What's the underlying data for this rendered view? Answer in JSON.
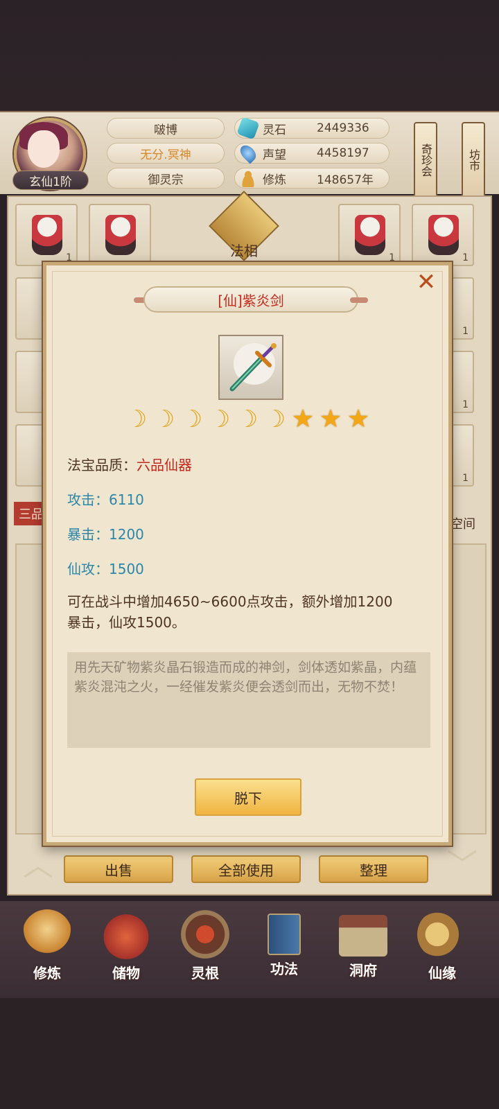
{
  "header": {
    "player_name": "啵博",
    "title": "无分.冥神",
    "sect": "御灵宗",
    "rank": "玄仙1阶",
    "resources": [
      {
        "label": "灵石",
        "value": "2449336",
        "icon": "spirit-stone-icon"
      },
      {
        "label": "声望",
        "value": "4458197",
        "icon": "reputation-icon"
      },
      {
        "label": "修炼",
        "value": "148657年",
        "icon": "meditation-icon"
      }
    ],
    "banners": [
      {
        "label": "奇珍会"
      },
      {
        "label": "坊市"
      }
    ]
  },
  "inventory": {
    "center_label": "法相",
    "left_tab": "三品",
    "right_tab": "子空间",
    "slot_count_value": "1"
  },
  "bottom_buttons": {
    "sell": "出售",
    "use_all": "全部使用",
    "sort": "整理"
  },
  "nav": [
    {
      "label": "修炼",
      "icon": "cultivate-icon"
    },
    {
      "label": "储物",
      "icon": "storage-bag-icon"
    },
    {
      "label": "灵根",
      "icon": "spirit-root-icon"
    },
    {
      "label": "功法",
      "icon": "technique-book-icon"
    },
    {
      "label": "洞府",
      "icon": "cave-mansion-icon"
    },
    {
      "label": "仙缘",
      "icon": "fate-icon"
    }
  ],
  "modal": {
    "title": "[仙]紫炎剑",
    "stars": {
      "moons": 6,
      "stars": 3
    },
    "quality_label": "法宝品质：",
    "quality_value": "六品仙器",
    "attack_label": "攻击：",
    "attack_value": "6110",
    "crit_label": "暴击：",
    "crit_value": "1200",
    "immortal_atk_label": "仙攻：",
    "immortal_atk_value": "1500",
    "effect_line1": "可在战斗中增加4650~6600点攻击，额外增加1200",
    "effect_line2": "暴击，仙攻1500。",
    "lore": "用先天矿物紫炎晶石锻造而成的神剑，剑体透如紫晶，内蕴紫炎混沌之火，一经催发紫炎便会透剑而出，无物不焚！",
    "unequip_label": "脱下",
    "close_symbol": "✕"
  },
  "colors": {
    "title_red": "#c42a1e",
    "attr_blue": "#2b86a8",
    "gold_button": "#f0b441"
  }
}
